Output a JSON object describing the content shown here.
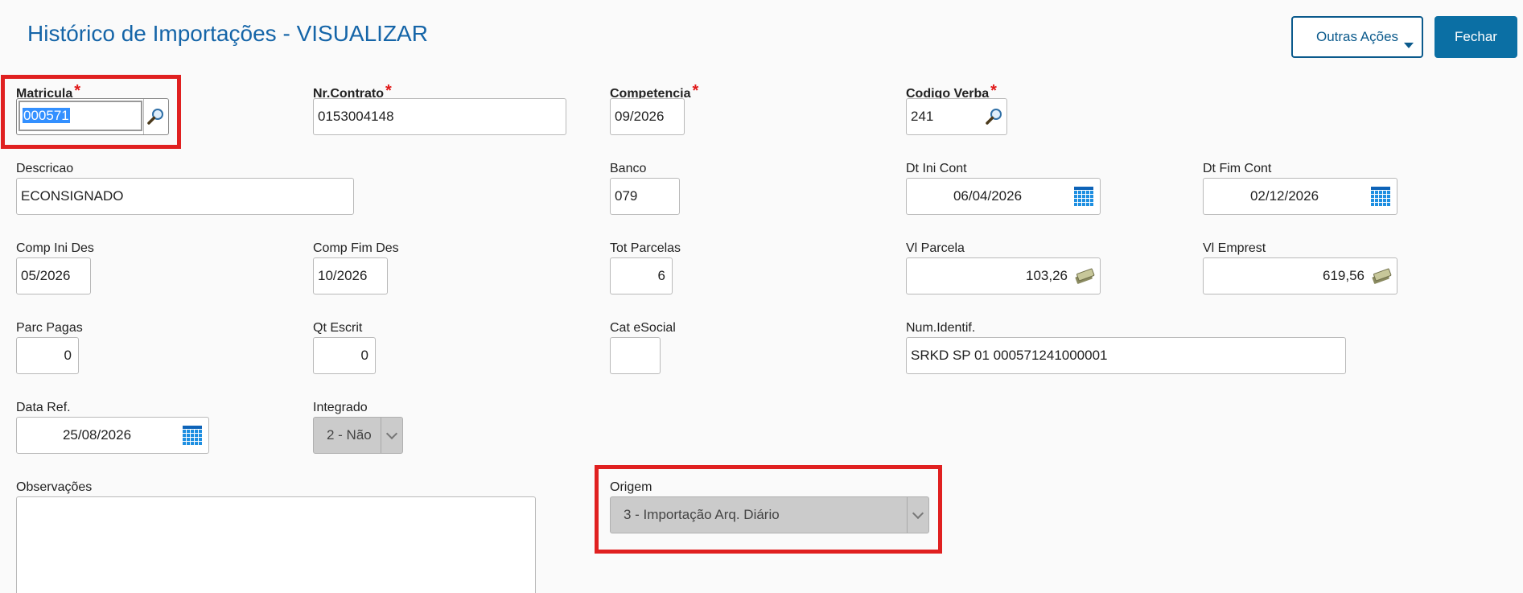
{
  "header": {
    "title": "Histórico de Importações - VISUALIZAR",
    "other_actions_label": "Outras Ações",
    "close_label": "Fechar"
  },
  "required_mark": "*",
  "fields": {
    "matricula": {
      "label": "Matricula",
      "value": "000571"
    },
    "nr_contrato": {
      "label": "Nr.Contrato",
      "value": "0153004148"
    },
    "competencia": {
      "label": "Competencia",
      "value": "09/2026"
    },
    "codigo_verba": {
      "label": "Codigo Verba",
      "value": "241"
    },
    "descricao": {
      "label": "Descricao",
      "value": "ECONSIGNADO"
    },
    "banco": {
      "label": "Banco",
      "value": "079"
    },
    "dt_ini_cont": {
      "label": "Dt Ini Cont",
      "value": "06/04/2026"
    },
    "dt_fim_cont": {
      "label": "Dt Fim Cont",
      "value": "02/12/2026"
    },
    "comp_ini_des": {
      "label": "Comp Ini Des",
      "value": "05/2026"
    },
    "comp_fim_des": {
      "label": "Comp Fim Des",
      "value": "10/2026"
    },
    "tot_parcelas": {
      "label": "Tot Parcelas",
      "value": "6"
    },
    "vl_parcela": {
      "label": "Vl Parcela",
      "value": "103,26"
    },
    "vl_emprest": {
      "label": "Vl Emprest",
      "value": "619,56"
    },
    "parc_pagas": {
      "label": "Parc Pagas",
      "value": "0"
    },
    "qt_escrit": {
      "label": "Qt Escrit",
      "value": "0"
    },
    "cat_esocial": {
      "label": "Cat eSocial",
      "value": ""
    },
    "num_identif": {
      "label": "Num.Identif.",
      "value": "SRKD SP 01 000571241000001"
    },
    "data_ref": {
      "label": "Data Ref.",
      "value": "25/08/2026"
    },
    "integrado": {
      "label": "Integrado",
      "value": "2 - Não"
    },
    "observacoes": {
      "label": "Observações",
      "value": ""
    },
    "origem": {
      "label": "Origem",
      "value": "3 - Importação Arq. Diário"
    }
  },
  "colors": {
    "title": "#1565a8",
    "primary_button": "#0b6fa4",
    "required_star": "#e01818",
    "highlight_box": "#e02020",
    "calendar_icon": "#1e8fe1"
  },
  "icons": {
    "lookup": "magnifier-icon",
    "calendar": "calendar-icon",
    "currency": "money-icon",
    "dropdown": "chevron-down-icon"
  }
}
